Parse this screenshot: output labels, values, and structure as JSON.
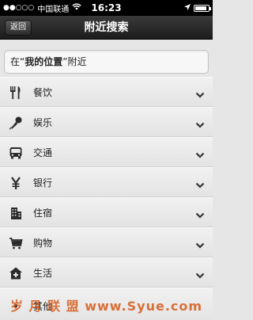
{
  "status_bar": {
    "signal": "●●○○○",
    "carrier": "中国联通",
    "time": "16:23",
    "battery_level": 0.85
  },
  "nav": {
    "back_label": "返回",
    "title": "附近搜索"
  },
  "search": {
    "prefix": "在“",
    "location": "我的位置",
    "suffix": "”附近"
  },
  "categories": [
    {
      "label": "餐饮",
      "icon": "fork-knife-icon"
    },
    {
      "label": "娱乐",
      "icon": "microphone-icon"
    },
    {
      "label": "交通",
      "icon": "bus-icon"
    },
    {
      "label": "银行",
      "icon": "yen-icon"
    },
    {
      "label": "住宿",
      "icon": "building-icon"
    },
    {
      "label": "购物",
      "icon": "cart-icon"
    },
    {
      "label": "生活",
      "icon": "house-plus-icon"
    },
    {
      "label": "其他",
      "icon": "dot-icon"
    }
  ],
  "watermark": "岁 月 联 盟  www.Syue.com"
}
